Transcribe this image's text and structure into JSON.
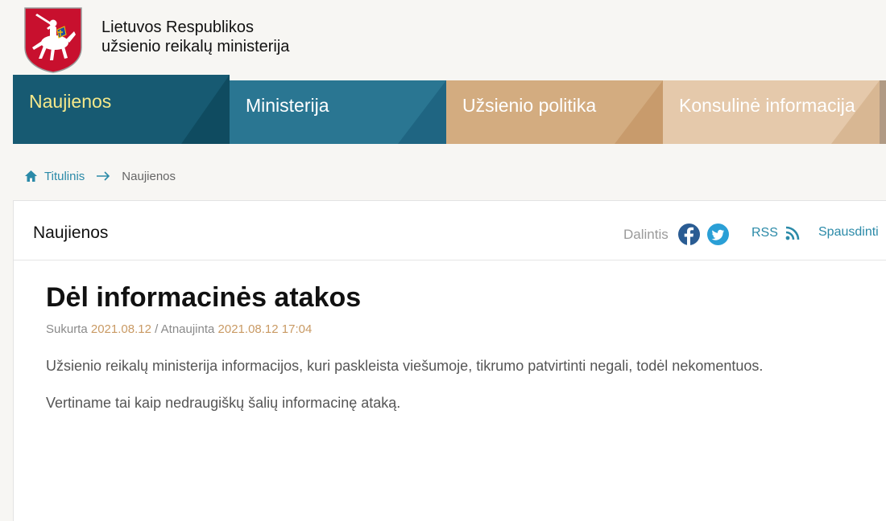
{
  "site": {
    "name_line1": "Lietuvos Respublikos",
    "name_line2": "užsienio reikalų ministerija",
    "logo_icon": "vytis-coat-of-arms-icon"
  },
  "nav": {
    "items": [
      {
        "label": "Naujienos",
        "color": "#175a72",
        "active": true
      },
      {
        "label": "Ministerija",
        "color": "#2a7692",
        "active": false
      },
      {
        "label": "Užsienio politika",
        "color": "#d3ac80",
        "active": false
      },
      {
        "label": "Konsulinė informacija",
        "color": "#e5c9ab",
        "active": false
      }
    ]
  },
  "breadcrumb": {
    "home_label": "Titulinis",
    "home_icon": "home-icon",
    "separator_icon": "arrow-right-icon",
    "current": "Naujienos"
  },
  "panel": {
    "title": "Naujienos",
    "share_label": "Dalintis",
    "facebook_icon": "facebook-icon",
    "twitter_icon": "twitter-icon",
    "rss_label": "RSS",
    "rss_icon": "rss-icon",
    "print_label": "Spausdinti"
  },
  "article": {
    "title": "Dėl informacinės atakos",
    "created_label": "Sukurta",
    "created_date": "2021.08.12",
    "separator": "/",
    "updated_label": "Atnaujinta",
    "updated_date": "2021.08.12 17:04",
    "paragraph1": "Užsienio reikalų ministerija informacijos, kuri paskleista viešumoje, tikrumo patvirtinti negali, todėl nekomentuos.",
    "paragraph2": "Vertiname tai kaip nedraugiškų šalių informacinę ataką."
  },
  "colors": {
    "link": "#2b8aa8",
    "date": "#c99a64",
    "active_nav_text": "#f6e98a",
    "facebook": "#2a5c93",
    "twitter": "#2a9fd6"
  }
}
